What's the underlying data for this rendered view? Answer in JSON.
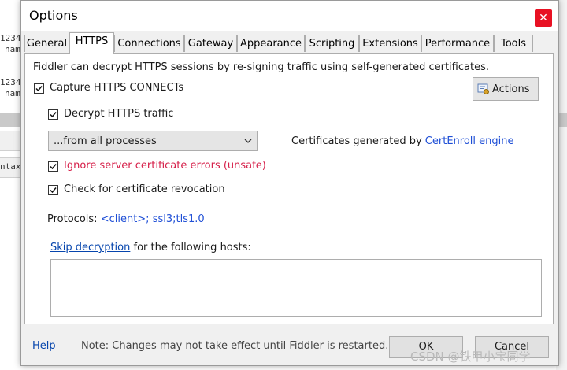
{
  "window": {
    "title": "Options"
  },
  "background": {
    "lines": [
      "1234",
      "nam",
      "1234",
      "nam"
    ],
    "syntax_label": "ntax"
  },
  "tabs": [
    {
      "label": "General",
      "active": false
    },
    {
      "label": "HTTPS",
      "active": true
    },
    {
      "label": "Connections",
      "active": false
    },
    {
      "label": "Gateway",
      "active": false
    },
    {
      "label": "Appearance",
      "active": false
    },
    {
      "label": "Scripting",
      "active": false
    },
    {
      "label": "Extensions",
      "active": false
    },
    {
      "label": "Performance",
      "active": false
    },
    {
      "label": "Tools",
      "active": false
    }
  ],
  "https": {
    "intro": "Fiddler can decrypt HTTPS sessions by re-signing traffic using self-generated certificates.",
    "capture_connects": {
      "label": "Capture HTTPS CONNECTs",
      "checked": true
    },
    "actions_label": "Actions",
    "decrypt_traffic": {
      "label": "Decrypt HTTPS traffic",
      "checked": true
    },
    "process_filter": {
      "selected": "...from all processes"
    },
    "certs_prefix": "Certificates generated by",
    "certs_engine": "CertEnroll engine",
    "ignore_errors": {
      "label": "Ignore server certificate errors (unsafe)",
      "checked": true
    },
    "check_revocation": {
      "label": "Check for certificate revocation",
      "checked": true
    },
    "protocols_prefix": "Protocols:",
    "protocols_value": "<client>; ssl3;tls1.0",
    "skip_link": "Skip decryption",
    "skip_suffix": "for the following hosts:",
    "hosts_value": ""
  },
  "footer": {
    "help": "Help",
    "note": "Note: Changes may not take effect until Fiddler is restarted.",
    "ok": "OK",
    "cancel": "Cancel"
  },
  "watermark": "CSDN @铁甲小宝同学",
  "colors": {
    "link": "#0645ad",
    "accent_blue": "#1f4fd6",
    "danger": "#d6204a",
    "close": "#e81123"
  }
}
